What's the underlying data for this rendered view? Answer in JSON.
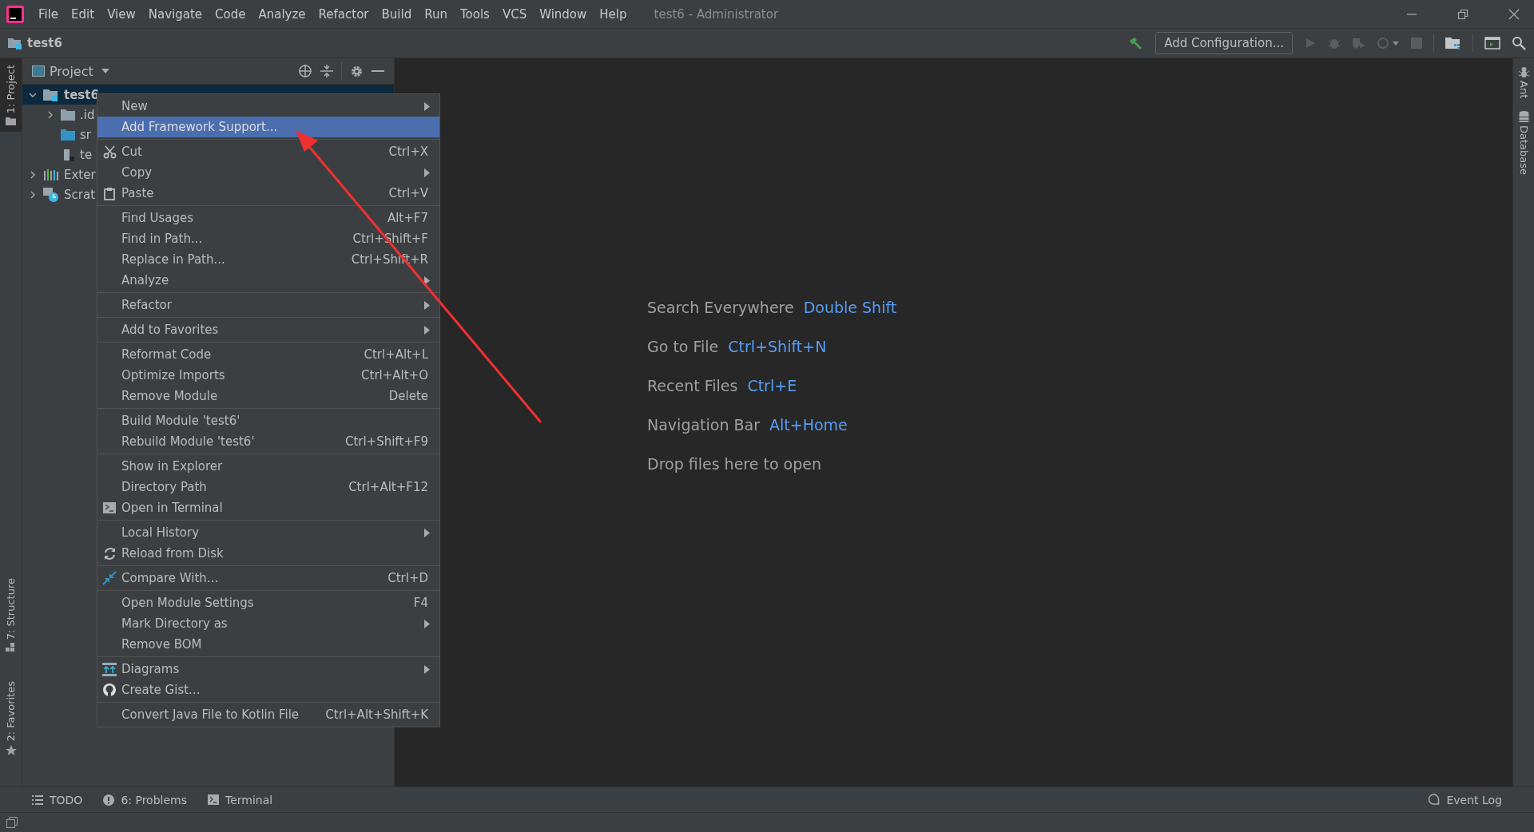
{
  "window": {
    "title": "test6 - Administrator"
  },
  "menu_bar": [
    "File",
    "Edit",
    "View",
    "Navigate",
    "Code",
    "Analyze",
    "Refactor",
    "Build",
    "Run",
    "Tools",
    "VCS",
    "Window",
    "Help"
  ],
  "nav_bar": {
    "crumb": "test6",
    "config_button": "Add Configuration..."
  },
  "left_stripe": {
    "top": [
      {
        "label": "1: Project",
        "selected": true
      }
    ],
    "bottom": [
      {
        "label": "7: Structure",
        "selected": false
      },
      {
        "label": "2: Favorites",
        "selected": false
      }
    ]
  },
  "right_stripe": [
    {
      "label": "Ant",
      "kind": "ant"
    },
    {
      "label": "Database",
      "kind": "database"
    }
  ],
  "project_panel": {
    "title": "Project",
    "tree": [
      {
        "label": "test6",
        "kind": "module",
        "expanded": true,
        "selected": true,
        "children": [
          {
            "label": ".id",
            "kind": "folder",
            "expanded": false,
            "selected": false
          },
          {
            "label": "sr",
            "kind": "source",
            "selected": false
          },
          {
            "label": "te",
            "kind": "file",
            "selected": false
          }
        ]
      },
      {
        "label": "Exter",
        "kind": "libraries",
        "expanded": false,
        "selected": false
      },
      {
        "label": "Scrat",
        "kind": "scratches",
        "expanded": false,
        "selected": false
      }
    ]
  },
  "context_menu": [
    [
      {
        "label": "New",
        "submenu": true,
        "selected": false
      },
      {
        "label": "Add Framework Support...",
        "submenu": false,
        "selected": true
      }
    ],
    [
      {
        "label": "Cut",
        "kind": "cut",
        "shortcut": "Ctrl+X",
        "submenu": false,
        "selected": false
      },
      {
        "label": "Copy",
        "submenu": true,
        "selected": false
      },
      {
        "label": "Paste",
        "kind": "paste",
        "shortcut": "Ctrl+V",
        "submenu": false,
        "selected": false
      }
    ],
    [
      {
        "label": "Find Usages",
        "shortcut": "Alt+F7",
        "submenu": false,
        "selected": false
      },
      {
        "label": "Find in Path...",
        "shortcut": "Ctrl+Shift+F",
        "submenu": false,
        "selected": false
      },
      {
        "label": "Replace in Path...",
        "shortcut": "Ctrl+Shift+R",
        "submenu": false,
        "selected": false
      },
      {
        "label": "Analyze",
        "submenu": true,
        "selected": false
      }
    ],
    [
      {
        "label": "Refactor",
        "submenu": true,
        "selected": false
      }
    ],
    [
      {
        "label": "Add to Favorites",
        "submenu": true,
        "selected": false
      }
    ],
    [
      {
        "label": "Reformat Code",
        "shortcut": "Ctrl+Alt+L",
        "submenu": false,
        "selected": false
      },
      {
        "label": "Optimize Imports",
        "shortcut": "Ctrl+Alt+O",
        "submenu": false,
        "selected": false
      },
      {
        "label": "Remove Module",
        "shortcut": "Delete",
        "submenu": false,
        "selected": false
      }
    ],
    [
      {
        "label": "Build Module 'test6'",
        "submenu": false,
        "selected": false
      },
      {
        "label": "Rebuild Module 'test6'",
        "shortcut": "Ctrl+Shift+F9",
        "submenu": false,
        "selected": false
      }
    ],
    [
      {
        "label": "Show in Explorer",
        "submenu": false,
        "selected": false
      },
      {
        "label": "Directory Path",
        "shortcut": "Ctrl+Alt+F12",
        "submenu": false,
        "selected": false
      },
      {
        "label": "Open in Terminal",
        "kind": "terminal",
        "submenu": false,
        "selected": false
      }
    ],
    [
      {
        "label": "Local History",
        "submenu": true,
        "selected": false
      },
      {
        "label": "Reload from Disk",
        "kind": "reload",
        "submenu": false,
        "selected": false
      }
    ],
    [
      {
        "label": "Compare With...",
        "kind": "compare",
        "shortcut": "Ctrl+D",
        "submenu": false,
        "selected": false
      }
    ],
    [
      {
        "label": "Open Module Settings",
        "shortcut": "F4",
        "submenu": false,
        "selected": false
      },
      {
        "label": "Mark Directory as",
        "submenu": true,
        "selected": false
      },
      {
        "label": "Remove BOM",
        "submenu": false,
        "selected": false
      }
    ],
    [
      {
        "label": "Diagrams",
        "kind": "diagrams",
        "submenu": true,
        "selected": false
      },
      {
        "label": "Create Gist...",
        "kind": "gist",
        "submenu": false,
        "selected": false
      }
    ],
    [
      {
        "label": "Convert Java File to Kotlin File",
        "shortcut": "Ctrl+Alt+Shift+K",
        "submenu": false,
        "selected": false
      }
    ]
  ],
  "editor_hints": [
    {
      "text": "Search Everywhere",
      "shortcut": "Double Shift"
    },
    {
      "text": "Go to File",
      "shortcut": "Ctrl+Shift+N"
    },
    {
      "text": "Recent Files",
      "shortcut": "Ctrl+E"
    },
    {
      "text": "Navigation Bar",
      "shortcut": "Alt+Home"
    },
    {
      "text": "Drop files here to open"
    }
  ],
  "tool_windows": [
    {
      "label": "TODO",
      "kind": "todo"
    },
    {
      "label": "6: Problems",
      "kind": "problems"
    },
    {
      "label": "Terminal",
      "kind": "terminal"
    }
  ],
  "event_log": "Event Log"
}
